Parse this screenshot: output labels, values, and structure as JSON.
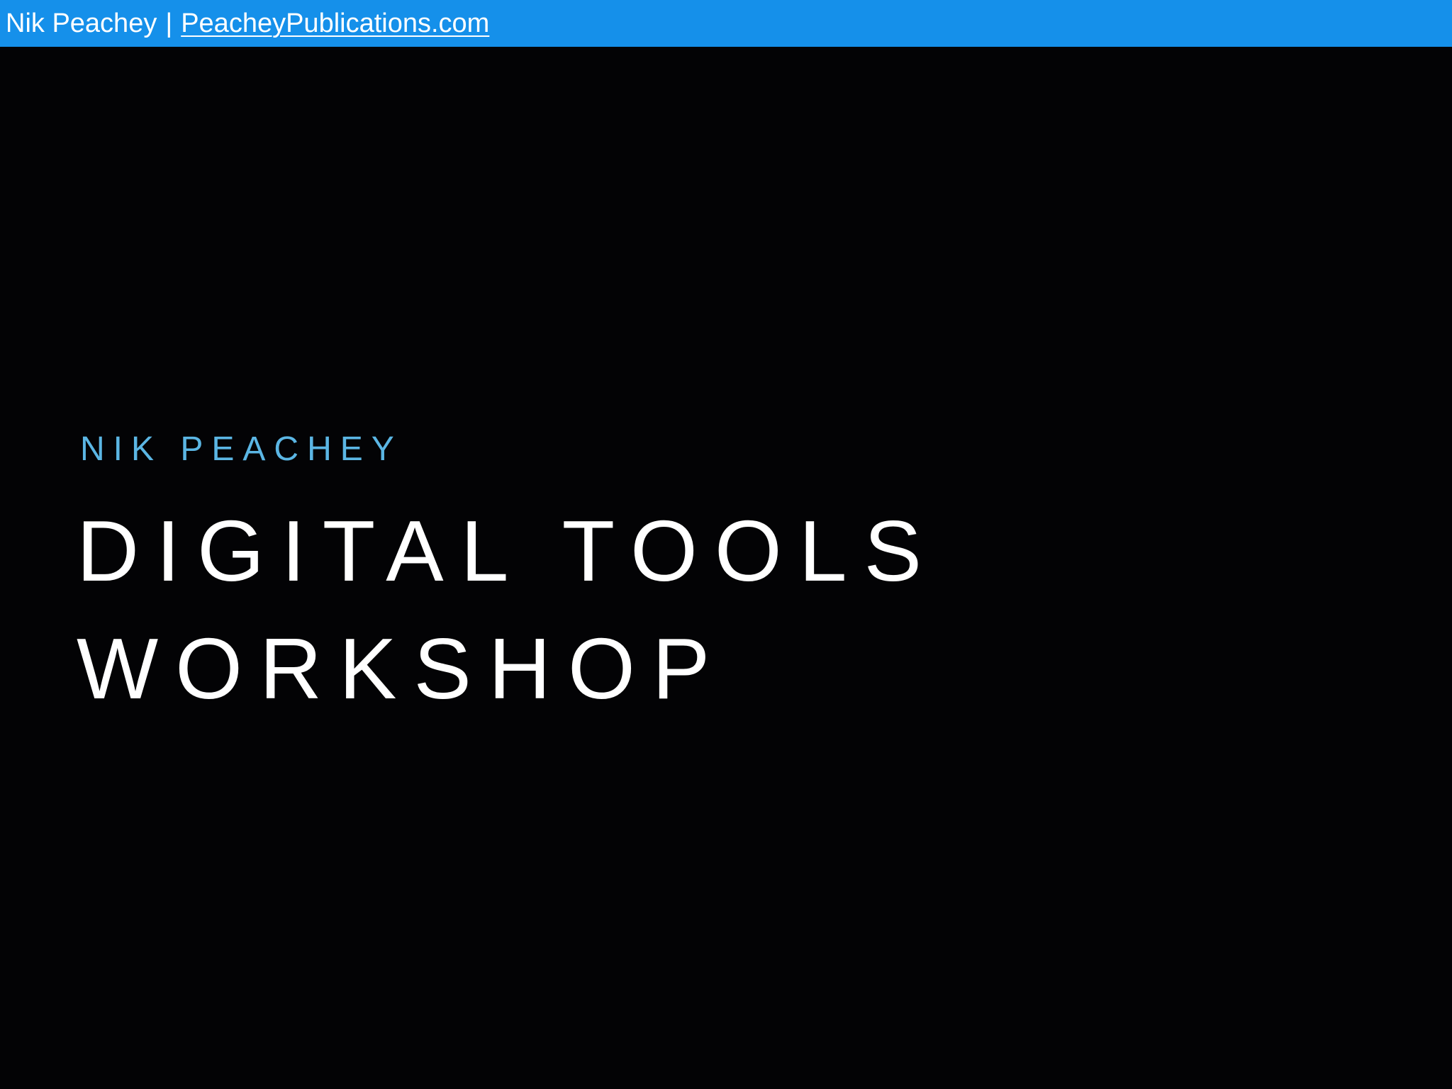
{
  "header": {
    "author_name": "Nik Peachey",
    "separator": "|",
    "website_link": "PeacheyPublications.com"
  },
  "slide": {
    "subtitle": "NIK PEACHEY",
    "title_lines": [
      "DIGITAL TOOLS",
      "WORKSHOP"
    ]
  },
  "colors": {
    "header_bar": "#1590EA",
    "subtitle_text": "#5BB6E4",
    "title_text": "#FFFFFF",
    "background": "#030305"
  }
}
